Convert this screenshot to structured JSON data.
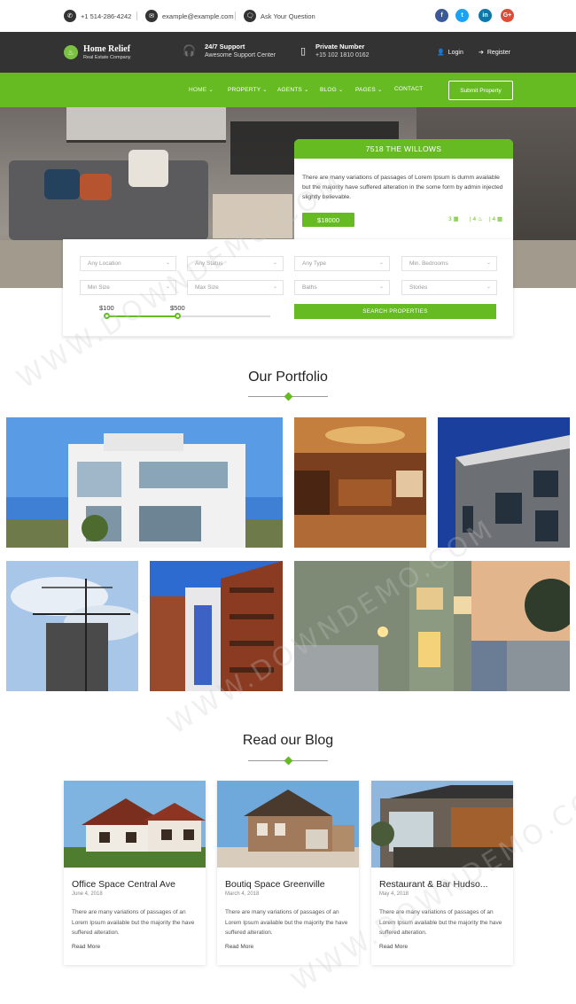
{
  "topbar": {
    "phone": "+1 514-286-4242",
    "email": "example@example.com",
    "ask": "Ask Your Question",
    "social": [
      {
        "icon": "facebook-icon",
        "glyph": "f",
        "color": "#3b5998"
      },
      {
        "icon": "twitter-icon",
        "glyph": "t",
        "color": "#1da1f2"
      },
      {
        "icon": "linkedin-icon",
        "glyph": "in",
        "color": "#0e76a8"
      },
      {
        "icon": "google-plus-icon",
        "glyph": "G+",
        "color": "#dd4b39"
      }
    ]
  },
  "header": {
    "logo_title": "Home Relief",
    "logo_sub": "Real Estate Company",
    "support_title": "24/7 Support",
    "support_sub": "Awesome Support Center",
    "private_title": "Private Number",
    "private_sub": "+15 102 1810 0162",
    "login": "Login",
    "register": "Register"
  },
  "nav": {
    "items": [
      "HOME",
      "PROPERTY",
      "AGENTS",
      "BLOG",
      "PAGES",
      "CONTACT"
    ],
    "submit": "Submit Property"
  },
  "property": {
    "title": "7518 THE WILLOWS",
    "desc": "There are many variations of passages of Lorem Ipsum is dumm available but the majority have suffered alteration in the some form by admin injected slightly believable.",
    "price": "$18000",
    "beds": "3",
    "baths": "4",
    "garages": "4"
  },
  "search": {
    "location": "Any Location",
    "status": "Any Status",
    "type": "Any Type",
    "bedrooms": "Min. Bedrooms",
    "min_size": "Min Size",
    "max_size": "Max Size",
    "baths": "Baths",
    "stories": "Stories",
    "range_min": "$100",
    "range_max": "$500",
    "button": "SEARCH PROPERTIES",
    "range_fraction": 0.44
  },
  "portfolio": {
    "title": "Our Portfolio"
  },
  "blog": {
    "title": "Read our Blog",
    "posts": [
      {
        "title": "Office Space Central Ave",
        "date": "June 4, 2018",
        "text": "There are many variations of passages of an Lorem Ipsum available but the majority the have suffered alteration.",
        "more": "Read More"
      },
      {
        "title": "Boutiq Space Greenville",
        "date": "March 4, 2018",
        "text": "There are many variations of passages of an Lorem Ipsum available but the majority the have suffered alteration.",
        "more": "Read More"
      },
      {
        "title": "Restaurant & Bar Hudso...",
        "date": "May 4, 2018",
        "text": "There are many variations of passages of an Lorem Ipsum available but the majority the have suffered alteration.",
        "more": "Read More"
      }
    ]
  },
  "watermark": "WWW.DOWNDEMO.COM",
  "colors": {
    "accent": "#66bb22",
    "dark": "#333333"
  }
}
